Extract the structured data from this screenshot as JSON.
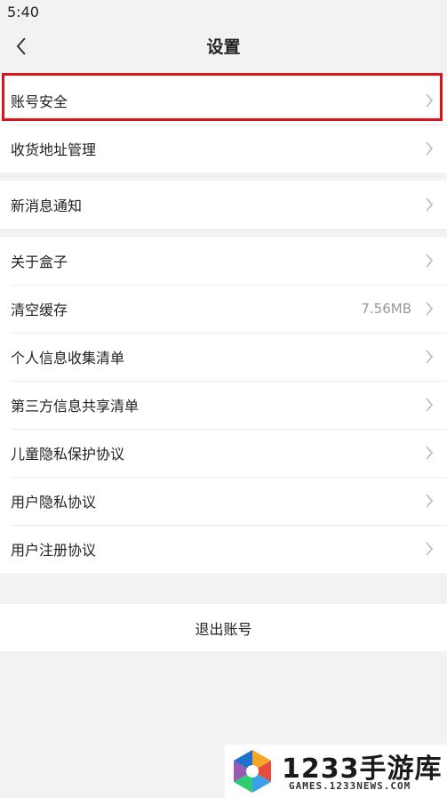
{
  "status_bar": {
    "time": "5:40"
  },
  "header": {
    "title": "设置",
    "back_icon": "chevron-left-icon"
  },
  "groups": [
    {
      "items": [
        {
          "label": "账号安全",
          "highlighted": true
        },
        {
          "label": "收货地址管理"
        }
      ]
    },
    {
      "items": [
        {
          "label": "新消息通知"
        }
      ]
    },
    {
      "items": [
        {
          "label": "关于盒子"
        },
        {
          "label": "清空缓存",
          "value": "7.56MB"
        },
        {
          "label": "个人信息收集清单"
        },
        {
          "label": "第三方信息共享清单"
        },
        {
          "label": "儿童隐私保护协议"
        },
        {
          "label": "用户隐私协议"
        },
        {
          "label": "用户注册协议"
        }
      ]
    }
  ],
  "logout": {
    "label": "退出账号"
  },
  "watermark": {
    "brand": "1233手游库",
    "url": "GAMES.1233NEWS.COM"
  },
  "colors": {
    "highlight": "#d9141a",
    "background": "#f2f2f2",
    "chevron": "#bbbbbb"
  }
}
